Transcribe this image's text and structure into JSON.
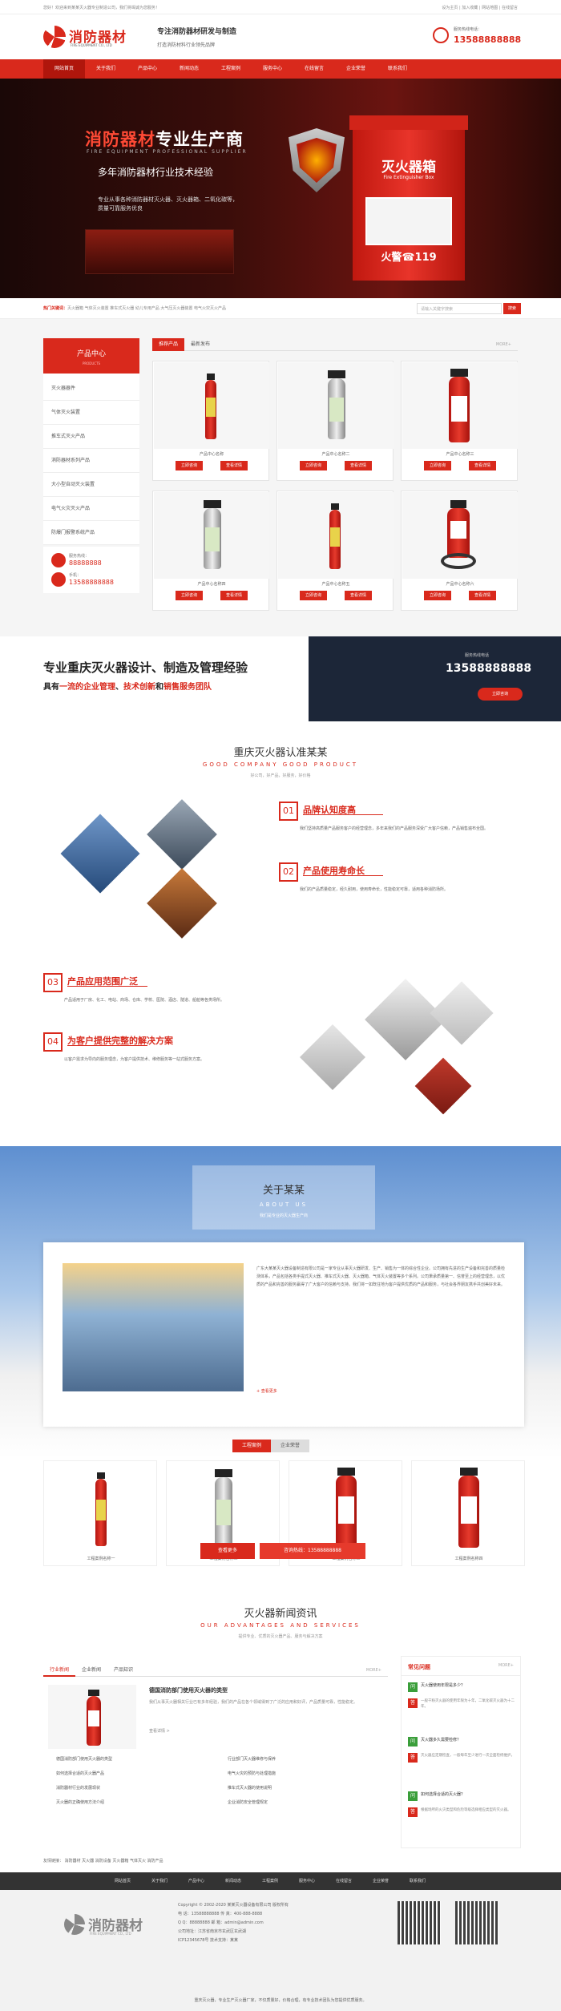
{
  "topbar": {
    "left": "您好！欢迎来到某某灭火器专业制造公司，我们将竭诚为您服务！",
    "right": "设为主页 | 加入收藏 | 网站地图 | 在线留言"
  },
  "header": {
    "logo_name": "消防器材",
    "logo_sub": "FIRE EQUIPMENT CO., LTD",
    "slogan_a": "专注消防器材研发与制造",
    "slogan_b": "打造消防材料行业领先品牌",
    "hotline_label": "服务热线电话：",
    "hotline": "13588888888"
  },
  "nav": [
    "网站首页",
    "关于我们",
    "产品中心",
    "新闻动态",
    "工程案例",
    "服务中心",
    "在线留言",
    "企业荣誉",
    "联系我们"
  ],
  "banner": {
    "h1_red": "消防器材",
    "h1_white": "专业生产商",
    "en": "FIRE EQUIPMENT PROFESSIONAL SUPPLIER",
    "h2": "多年消防器材行业技术经验",
    "p": "专业从事各种消防器材灭火器、灭火器箱、二氧化碳等，质量可靠服务优良",
    "box_l1": "灭火器箱",
    "box_l2": "Fire Extinguisher Box",
    "box_l3": "火警☎119"
  },
  "search": {
    "label": "热门关键词：",
    "keywords": "灭火器箱  气体灭火装置  推车式灭火器  幼儿专用产品  大气压灭火器装置  电气火灾灭火产品",
    "placeholder": "请输入关键字搜索",
    "button": "搜索"
  },
  "products": {
    "side_title": "产品中心",
    "side_sub": "PRODUCTS",
    "categories": [
      "灭火器器件",
      "气体灭火装置",
      "推车式灭火产品",
      "消防器材系列产品",
      "大小型自动灭火装置",
      "电气火灾灭火产品",
      "防爆门报警系统产品"
    ],
    "contact": [
      {
        "t": "服务热线：",
        "v": "88888888"
      },
      {
        "t": "手机：",
        "v": "13588888888"
      }
    ],
    "tabs": [
      "推荐产品",
      "最新发布"
    ],
    "more": "MORE+",
    "items": [
      {
        "name": "产品中心名称",
        "b1": "立即咨询",
        "b2": "查看详情"
      },
      {
        "name": "产品中心名称二",
        "b1": "立即咨询",
        "b2": "查看详情"
      },
      {
        "name": "产品中心名称三",
        "b1": "立即咨询",
        "b2": "查看详情"
      },
      {
        "name": "产品中心名称四",
        "b1": "立即咨询",
        "b2": "查看详情"
      },
      {
        "name": "产品中心名称五",
        "b1": "立即咨询",
        "b2": "查看详情"
      },
      {
        "name": "产品中心名称六",
        "b1": "立即咨询",
        "b2": "查看详情"
      }
    ]
  },
  "ad": {
    "h": "专业重庆灭火器设计、制造及管理经验",
    "s1": "具有",
    "s2": "一流的企业管理",
    "s3": "、",
    "s4": "技术创新",
    "s5": "和",
    "s6": "销售服务团队",
    "r1": "服务热线电话",
    "r2": "13588888888",
    "r3": "立即咨询"
  },
  "why": {
    "title": "重庆灭火器认准某某",
    "en": "GOOD COMPANY GOOD PRODUCT",
    "desc": "好公司，好产品，好服务，好价格",
    "items": [
      {
        "n": "01",
        "t": "品牌认知度高",
        "d": "我们坚持高质量产品服务客户的经营理念，多年来我们的产品服务深受广大客户信赖，产品销售遍布全国。"
      },
      {
        "n": "02",
        "t": "产品使用寿命长",
        "d": "我们的产品质量稳定，经久耐用，使用寿命长，性能稳定可靠，适用各种消防场所。"
      },
      {
        "n": "03",
        "t": "产品应用范围广泛",
        "d": "产品适用于厂房、化工、电站、商场、仓库、学校、医院、酒店、隧道、船舶等各类场所。"
      },
      {
        "n": "04",
        "t": "为客户提供完整的解决方案",
        "d": "以客户需求为导向的服务理念，为客户提供技术、维修服务等一站式服务方案。"
      }
    ]
  },
  "about": {
    "title": "关于某某",
    "en": "ABOUT US",
    "desc": "我们是专业的灭火器生产商",
    "text": "广东大某某灭火器设备制造有限公司是一家专业从事灭火器研发、生产、销售为一体的综合性企业。公司拥有先进的生产设备和完善的质量检测体系，产品包括各类手提式灭火器、推车式灭火器、灭火器箱、气体灭火装置等多个系列。公司秉承质量第一、信誉至上的经营理念，以优质的产品和完善的服务赢得了广大客户的信赖与支持。我们将一如既往地为客户提供优质的产品和服务，与社会各界朋友携手共创美好未来。",
    "more": "+ 查看更多",
    "tabs": [
      "工程案例",
      "企业荣誉"
    ],
    "cases": [
      "工程案例名称一",
      "工程案例名称二",
      "工程案例名称三",
      "工程案例名称四"
    ],
    "btn1": "查看更多",
    "btn2": "咨询热线：13588888888"
  },
  "news": {
    "title": "灭火器新闻资讯",
    "en": "OUR ADVANTAGES AND SERVICES",
    "desc": "提供专业、优质的灭火器产品、服务与解决方案",
    "tabs": [
      "行业新闻",
      "企业新闻",
      "产品知识"
    ],
    "more": "MORE+",
    "featured_title": "德国消防部门使用灭火器的类型",
    "featured_text": "我们从事灭火器相关行业已有多年经验，我们的产品在各个领域得到了广泛的应用和好评，产品质量可靠，性能稳定。",
    "featured_more": "查看详情 >",
    "left": [
      "德国消防部门使用灭火器的类型",
      "如何选择合适的灭火器产品",
      "消防器材行业的发展现状",
      "灭火器的正确使用方法介绍"
    ],
    "right": [
      "行业部门灭火器维修与保养",
      "电气火灾的预防与处理措施",
      "推车式灭火器的使用说明",
      "企业消防安全管理规定"
    ],
    "faq_title": "常见问题",
    "faq_more": "MORE+",
    "faq": [
      {
        "q": "灭火器使用年限是多少？",
        "a": "一般干粉灭火器的使用年限为十年，二氧化碳灭火器为十二年。"
      },
      {
        "q": "灭火器多久需要检修？",
        "a": "灭火器应定期检查，一般每年至少进行一次全面检修维护。"
      },
      {
        "q": "如何选择合适的灭火器？",
        "a": "根据场所的火灾类型和危险等级选择相应类型的灭火器。"
      }
    ]
  },
  "links": "友情链接：  消防器材  灭火器  消防设备  灭火器箱  气体灭火  消防产品",
  "footer": {
    "nav": [
      "网站首页",
      "关于我们",
      "产品中心",
      "新闻动态",
      "工程案例",
      "服务中心",
      "在线留言",
      "企业荣誉",
      "联系我们"
    ],
    "logo": "消防器材",
    "logo_sub": "FIRE EQUIPMENT CO., LTD",
    "lines": [
      "Copyright © 2002-2020 某某灭火器设备有限公司 版权所有",
      "电 话：13588888888    传 真：400-888-8888",
      "Q Q：88888888    邮 箱：admin@admin.com",
      "公司地址：江苏省南京市玄武区玄武湖",
      "ICP12345678号    技术支持：某某"
    ],
    "bottom": "重庆灭火器，专业生产灭火器厂家，不仅质量好，价格合理，有专业技术团队为您提供优质服务。"
  },
  "colors": {
    "accent": "#d9291c",
    "nav_active": "#b0160c",
    "footer_nav": "#333333"
  }
}
